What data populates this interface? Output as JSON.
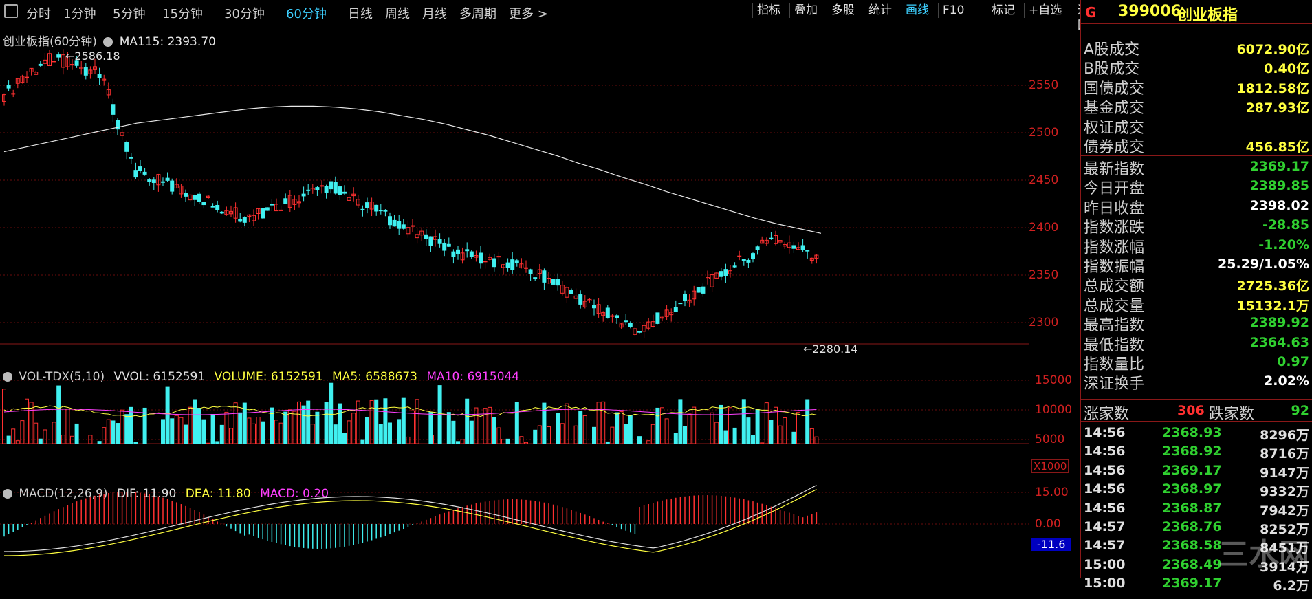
{
  "topbar": {
    "periods": [
      "分时",
      "1分钟",
      "5分钟",
      "15分钟",
      "30分钟",
      "60分钟",
      "日线",
      "周线",
      "月线",
      "多周期",
      "更多 >"
    ],
    "active_period": "60分钟",
    "tools": [
      "指标",
      "叠加",
      "多股",
      "统计",
      "画线",
      "F10",
      "标记",
      "+自选",
      "返回"
    ],
    "active_tool": "画线"
  },
  "main_chart": {
    "legend_name": "创业板指(60分钟)",
    "legend_ma": "MA115: 2393.70",
    "high_label": "2586.18",
    "low_label": "2280.14",
    "y_ticks": [
      "2550",
      "2500",
      "2450",
      "2400",
      "2350",
      "2300"
    ]
  },
  "vol_panel": {
    "legend": {
      "name": "VOL-TDX(5,10)",
      "vvol": "VVOL: 6152591",
      "volume": "VOLUME: 6152591",
      "ma5": "MA5: 6588673",
      "ma10": "MA10: 6915044"
    },
    "y_ticks": [
      "15000",
      "10000",
      "5000"
    ],
    "unit": "X1000"
  },
  "macd_panel": {
    "legend": {
      "name": "MACD(12,26,9)",
      "dif": "DIF: 11.90",
      "dea": "DEA: 11.80",
      "macd": "MACD: 0.20"
    },
    "y_ticks": [
      "15.00",
      "0.00"
    ],
    "cursor_value": "-11.6"
  },
  "sidebar": {
    "flag": "G",
    "code": "399006",
    "name": "创业板指",
    "market": [
      {
        "k": "A股成交",
        "v": "6072.90亿"
      },
      {
        "k": "B股成交",
        "v": "0.40亿"
      },
      {
        "k": "国债成交",
        "v": "1812.58亿"
      },
      {
        "k": "基金成交",
        "v": "287.93亿"
      },
      {
        "k": "权证成交",
        "v": ""
      },
      {
        "k": "债券成交",
        "v": "456.85亿"
      }
    ],
    "quote": [
      {
        "k": "最新指数",
        "v": "2369.17"
      },
      {
        "k": "今日开盘",
        "v": "2389.85"
      },
      {
        "k": "昨日收盘",
        "v": "2398.02"
      },
      {
        "k": "指数涨跌",
        "v": "-28.85"
      },
      {
        "k": "指数涨幅",
        "v": "-1.20%"
      },
      {
        "k": "指数振幅",
        "v": "25.29/1.05%"
      },
      {
        "k": "总成交额",
        "v": "2725.36亿"
      },
      {
        "k": "总成交量",
        "v": "15132.1万"
      },
      {
        "k": "最高指数",
        "v": "2389.92"
      },
      {
        "k": "最低指数",
        "v": "2364.63"
      },
      {
        "k": "指数量比",
        "v": "0.97"
      },
      {
        "k": "深证换手",
        "v": "2.02%"
      }
    ],
    "breadth": {
      "up_label": "涨家数",
      "up": "306",
      "down_label": "跌家数",
      "down": "92"
    },
    "ticks": [
      {
        "time": "14:56",
        "price": "2368.93",
        "vol": "8296万"
      },
      {
        "time": "14:56",
        "price": "2368.92",
        "vol": "8716万"
      },
      {
        "time": "14:56",
        "price": "2369.17",
        "vol": "9147万"
      },
      {
        "time": "14:56",
        "price": "2368.97",
        "vol": "9332万"
      },
      {
        "time": "14:56",
        "price": "2368.87",
        "vol": "7942万"
      },
      {
        "time": "14:57",
        "price": "2368.76",
        "vol": "8252万"
      },
      {
        "time": "14:57",
        "price": "2368.58",
        "vol": "8451万"
      },
      {
        "time": "15:00",
        "price": "2368.49",
        "vol": "3914万"
      },
      {
        "time": "15:00",
        "price": "2369.17",
        "vol": "6.2万"
      }
    ]
  },
  "watermark": "三水网",
  "colors": {
    "up": "#ff3030",
    "down": "#40f0f0",
    "ma": "#e8e8e8",
    "ma5": "#ffff40",
    "ma10": "#ff40ff",
    "grid": "#6a0d0d"
  },
  "chart_data": {
    "type": "candlestick",
    "y_range": [
      2280,
      2590
    ],
    "ma115": [
      2480,
      2485,
      2490,
      2495,
      2500,
      2505,
      2510,
      2513,
      2516,
      2519,
      2522,
      2525,
      2527,
      2528,
      2528,
      2527,
      2525,
      2522,
      2518,
      2514,
      2509,
      2503,
      2497,
      2490,
      2483,
      2476,
      2468,
      2461,
      2453,
      2446,
      2438,
      2431,
      2424,
      2417,
      2410,
      2404,
      2399,
      2394
    ]
  }
}
